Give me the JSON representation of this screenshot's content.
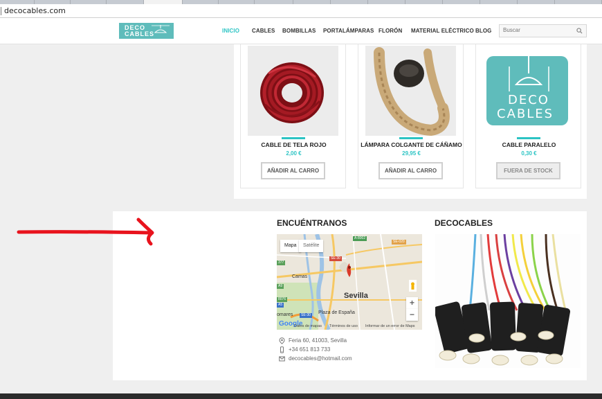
{
  "browser": {
    "url": "decocables.com"
  },
  "header": {
    "logo_line1": "DECO",
    "logo_line2": "CABLES",
    "nav": [
      {
        "label": "INICIO",
        "active": true
      },
      {
        "label": "CABLES",
        "active": false
      },
      {
        "label": "BOMBILLAS",
        "active": false
      },
      {
        "label": "PORTALÁMPARAS",
        "active": false
      },
      {
        "label": "FLORÓN",
        "active": false
      },
      {
        "label": "MATERIAL ELÉCTRICO",
        "active": false
      },
      {
        "label": "BLOG",
        "active": false
      }
    ],
    "search_placeholder": "Buscar"
  },
  "products": [
    {
      "name": "CABLE DE TELA ROJO",
      "price": "2,00 €",
      "button": "AÑADIR AL CARRO",
      "image": "red-cable-coil"
    },
    {
      "name": "LÁMPARA COLGANTE DE CÁÑAMO",
      "price": "29,95 €",
      "button": "AÑADIR AL CARRO",
      "image": "hemp-rope-lamp"
    },
    {
      "name": "CABLE PARALELO",
      "price": "0,30 €",
      "button": "FUERA DE STOCK",
      "image": "decocables-logo"
    }
  ],
  "find_us": {
    "title": "ENCUÉNTRANOS",
    "map": {
      "tab_map": "Mapa",
      "tab_satellite": "Satélite",
      "city": "Sevilla",
      "towns": [
        "Camas",
        "Plaza de España",
        "omares"
      ],
      "roads": [
        "A-8002",
        "SE-020",
        "SE-30",
        "SE-30",
        "8076",
        "A5",
        "377",
        "A9"
      ],
      "zoom_in": "+",
      "zoom_out": "−",
      "google": "Google",
      "attrib_data": "Datos de mapas",
      "attrib_terms": "Términos de uso",
      "attrib_report": "Informar de un error de Maps"
    },
    "address": "Feria 60, 41003, Sevilla",
    "phone": "+34 651 813 733",
    "email": "decocables@hotmail.com"
  },
  "decocables_section": {
    "title": "DECOCABLES"
  },
  "colors": {
    "accent": "#2cc4c4",
    "logo_bg": "#5fbcbb",
    "annotation_arrow": "#e8131d"
  }
}
